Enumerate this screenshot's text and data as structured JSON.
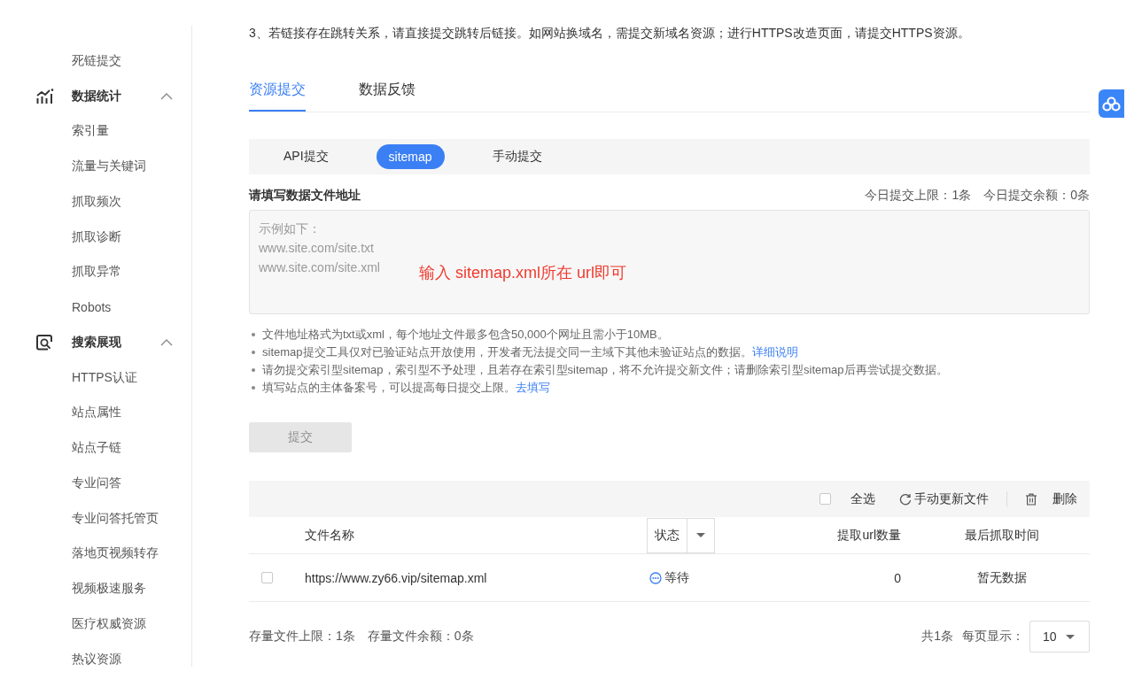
{
  "sidebar": {
    "items": [
      {
        "kind": "link",
        "label": "死链提交",
        "selected": false
      },
      {
        "kind": "group",
        "label": "数据统计",
        "expanded": true,
        "children": [
          {
            "label": "索引量",
            "selected": false
          },
          {
            "label": "流量与关键词",
            "selected": false
          },
          {
            "label": "抓取频次",
            "selected": false
          },
          {
            "label": "抓取诊断",
            "selected": false
          },
          {
            "label": "抓取异常",
            "selected": false
          },
          {
            "label": "Robots",
            "selected": false
          }
        ]
      },
      {
        "kind": "group",
        "label": "搜索展现",
        "expanded": true,
        "children": [
          {
            "label": "HTTPS认证",
            "selected": false
          },
          {
            "label": "站点属性",
            "selected": false
          },
          {
            "label": "站点子链",
            "selected": false
          },
          {
            "label": "专业问答",
            "selected": false
          },
          {
            "label": "专业问答托管页",
            "selected": false
          },
          {
            "label": "落地页视频转存",
            "selected": false
          },
          {
            "label": "视频极速服务",
            "selected": false
          },
          {
            "label": "医疗权威资源",
            "selected": false
          },
          {
            "label": "热议资源",
            "selected": false
          }
        ]
      }
    ]
  },
  "notice": "3、若链接存在跳转关系，请直接提交跳转后链接。如网站换域名，需提交新域名资源；进行HTTPS改造页面，请提交HTTPS资源。",
  "tabs": [
    {
      "label": "资源提交",
      "selected": true
    },
    {
      "label": "数据反馈",
      "selected": false
    }
  ],
  "submit_methods": [
    {
      "label": "API提交",
      "selected": false
    },
    {
      "label": "sitemap",
      "selected": true
    },
    {
      "label": "手动提交",
      "selected": false
    }
  ],
  "form": {
    "label": "请填写数据文件地址",
    "quota": [
      "今日提交上限：1条",
      "今日提交余额：0条"
    ],
    "field": {
      "placeholder": "示例如下：\nwww.site.com/site.txt\nwww.site.com/site.xml"
    },
    "annotation": "输入 sitemap.xml所在 url即可",
    "notes": [
      {
        "text": "文件地址格式为txt或xml，每个地址文件最多包含50,000个网址且需小于10MB。"
      },
      {
        "text": "sitemap提交工具仅对已验证站点开放使用，开发者无法提交同一主域下其他未验证站点的数据。",
        "link": "详细说明"
      },
      {
        "text": "请勿提交索引型sitemap，索引型不予处理，且若存在索引型sitemap，将不允许提交新文件；请删除索引型sitemap后再尝试提交数据。"
      },
      {
        "text": "填写站点的主体备案号，可以提高每日提交上限。",
        "link": "去填写"
      }
    ],
    "submit": {
      "label": "提交",
      "disabled": true
    }
  },
  "table": {
    "toolbar": {
      "select_all": {
        "label": "全选",
        "checked": false
      },
      "refresh": "手动更新文件",
      "delete": "删除"
    },
    "columns": [
      {
        "kind": "text",
        "label": "文件名称"
      },
      {
        "kind": "filter",
        "label": "状态"
      },
      {
        "kind": "text",
        "label": "提取url数量"
      },
      {
        "kind": "text",
        "label": "最后抓取时间"
      }
    ],
    "rows": [
      {
        "checked": false,
        "file": "https://www.zy66.vip/sitemap.xml",
        "status": {
          "kind": "waiting",
          "label": "等待"
        },
        "url_count": "0",
        "last_crawl": "暂无数据"
      }
    ]
  },
  "footer": {
    "storage": [
      "存量文件上限：1条",
      "存量文件余额：0条"
    ],
    "total": "共1条",
    "page_size_label": "每页显示：",
    "page_size": "10"
  }
}
